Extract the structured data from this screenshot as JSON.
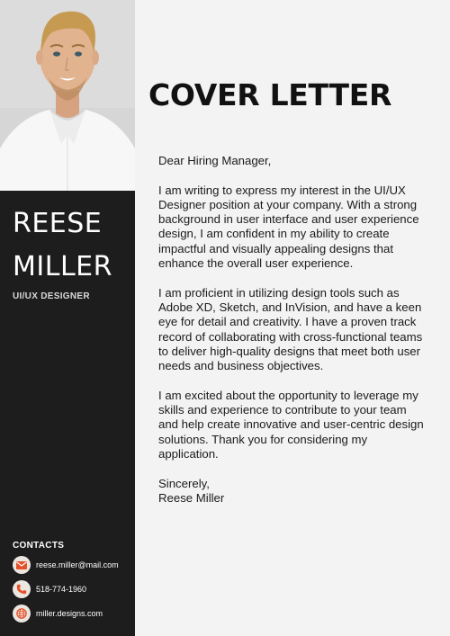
{
  "profile": {
    "first_name": "REESE",
    "last_name": "MILLER",
    "role": "UI/UX DESIGNER"
  },
  "contacts": {
    "heading": "CONTACTS",
    "items": [
      {
        "icon": "envelope-icon",
        "text": "reese.miller@mail.com"
      },
      {
        "icon": "phone-icon",
        "text": "518-774-1960"
      },
      {
        "icon": "globe-icon",
        "text": "miller.designs.com"
      }
    ]
  },
  "letter": {
    "title": "COVER LETTER",
    "greeting": "Dear Hiring Manager,",
    "paragraphs": [
      "I am writing to express my interest in the UI/UX Designer position at your company. With a strong background in user interface and user experience design, I am confident in my ability to create impactful and visually appealing designs that enhance the overall user experience.",
      "I am proficient in utilizing design tools such as Adobe XD, Sketch, and InVision, and have a keen eye for detail and creativity. I have a proven track record of collaborating with cross-functional teams to deliver high-quality designs that meet both user needs and business objectives.",
      "I am excited about the opportunity to leverage my skills and experience to contribute to your team and help create innovative and user-centric design solutions. Thank you for considering my application."
    ],
    "closing": "Sincerely,",
    "signature": "Reese Miller"
  },
  "colors": {
    "sidebar": "#1d1d1d",
    "page": "#f3f3f3",
    "icon_accent": "#e5512a"
  }
}
